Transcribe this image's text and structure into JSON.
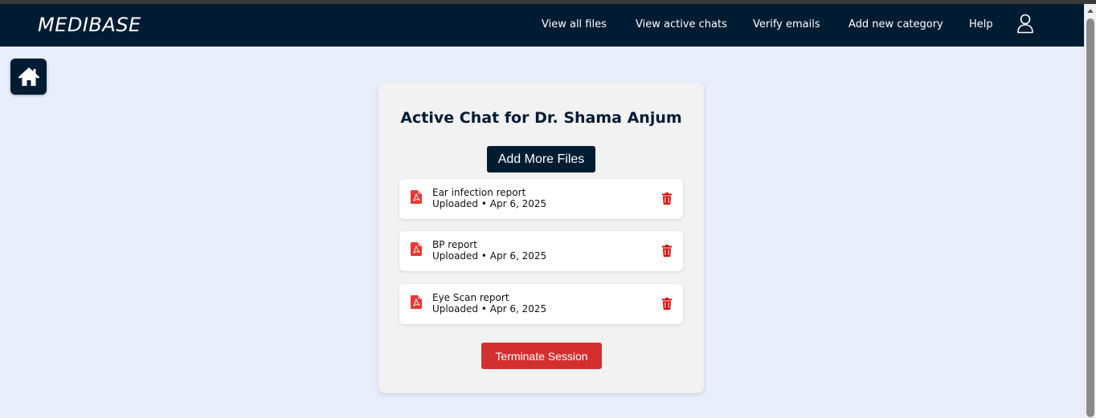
{
  "brand": "MEDIBASE",
  "nav": {
    "links": [
      "View all files",
      "View active chats",
      "Verify emails",
      "Add new category",
      "Help"
    ],
    "user_icon": "user-icon"
  },
  "home_icon": "home-icon",
  "card": {
    "title": "Active Chat for Dr. Shama Anjum",
    "add_files_label": "Add More Files",
    "files": [
      {
        "name": "Ear infection report",
        "meta": "Uploaded • Apr 6, 2025",
        "icon": "pdf-icon"
      },
      {
        "name": "BP report",
        "meta": "Uploaded • Apr 6, 2025",
        "icon": "pdf-icon"
      },
      {
        "name": "Eye Scan report",
        "meta": "Uploaded • Apr 6, 2025",
        "icon": "pdf-icon"
      }
    ],
    "terminate_label": "Terminate Session"
  },
  "colors": {
    "navbar": "#001c33",
    "background": "#e8eefc",
    "danger": "#d32f2f",
    "pdf": "#e53935"
  }
}
